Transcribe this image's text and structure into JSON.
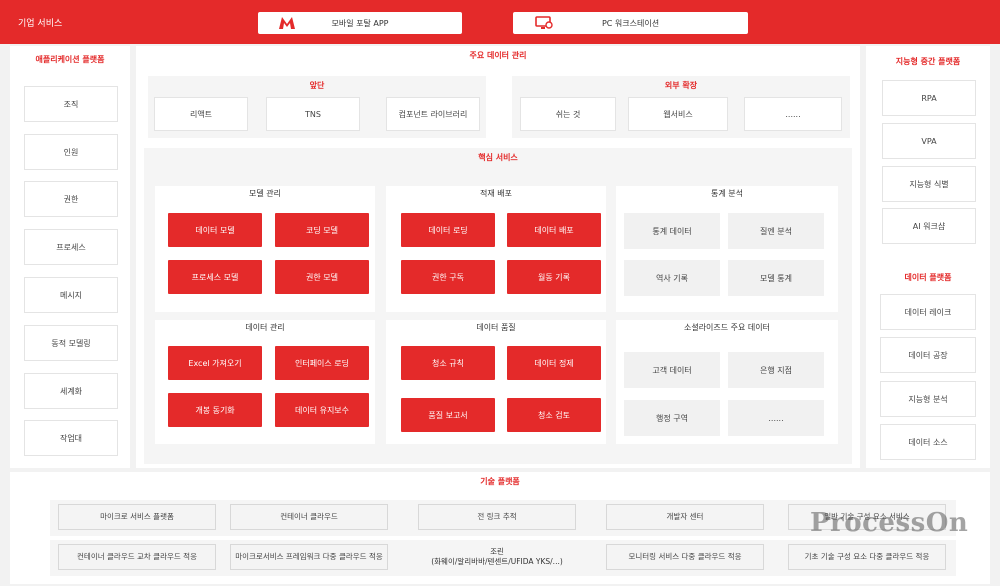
{
  "header": {
    "title": "기업 서비스",
    "mobile_label": "모바일 포탈 APP",
    "pc_label": "PC 워크스테이션"
  },
  "left": {
    "title": "애플리케이션 플랫폼",
    "items": [
      "조직",
      "인원",
      "권한",
      "프로세스",
      "메시지",
      "동적 모델링",
      "세계화",
      "작업대"
    ]
  },
  "center": {
    "title": "주요 데이터 관리",
    "frontend": {
      "title": "앞단",
      "items": [
        "리액트",
        "TNS",
        "컴포넌트 라이브러리"
      ]
    },
    "external": {
      "title": "외부 확장",
      "items": [
        "쉬는 것",
        "웹서비스",
        "......"
      ]
    },
    "core": {
      "title": "핵심 서비스",
      "model": {
        "title": "모델 관리",
        "items": [
          "데이터 모델",
          "코딩 모델",
          "프로세스 모델",
          "권한 모델"
        ]
      },
      "deploy": {
        "title": "적재 배포",
        "items": [
          "데이터 로딩",
          "데이터 배포",
          "권한 구독",
          "월동 기록"
        ]
      },
      "stats": {
        "title": "통계 분석",
        "items": [
          "통계 데이터",
          "질엔 분석",
          "역사 기록",
          "모델 통계"
        ]
      },
      "datamgmt": {
        "title": "데이터 관리",
        "items": [
          "Excel 가져오기",
          "인터페이스 로딩",
          "개봉 동기화",
          "데이터 유지보수"
        ]
      },
      "quality": {
        "title": "데이터 품질",
        "items": [
          "청소 규칙",
          "데이터 정제",
          "품질 보고서",
          "청소 검토"
        ]
      },
      "social": {
        "title": "소셜라이즈드 주요 데이터",
        "items": [
          "고객 데이터",
          "은행 지점",
          "행정 구역",
          "......"
        ]
      }
    }
  },
  "right": {
    "ai_title": "지능형 중간 플랫폼",
    "ai_items": [
      "RPA",
      "VPA",
      "지능형 식별",
      "AI 워크샵"
    ],
    "data_title": "데이터 플랫폼",
    "data_items": [
      "데이터 레이크",
      "데이터 공장",
      "지능형 분석",
      "데이터 소스"
    ]
  },
  "tech": {
    "title": "기술 플랫폼",
    "row1": [
      "마이크로 서비스 플랫폼",
      "컨테이너 클라우드",
      "전 링크 추적",
      "개발자 센터",
      "일반 기술 구성 요소 서비스"
    ],
    "row2": [
      "컨테이너 클라우드 교차 클라우드 적응",
      "마이크로서비스 프레임워크 다중 클라우드 적응",
      "조린\n(화웨이/알리바바/텐센트/UFIDA YKS/...)",
      "모니터링 서비스 다중 클라우드 적응",
      "기초 기술 구성 요소 다중 클라우드 적응"
    ]
  },
  "watermark": "ProcessOn",
  "colors": {
    "accent": "#e42a2a",
    "panel": "#ffffff",
    "background": "#f2f2f2"
  },
  "icons": {
    "mobile": "m-logo-icon",
    "pc": "workstation-icon"
  }
}
